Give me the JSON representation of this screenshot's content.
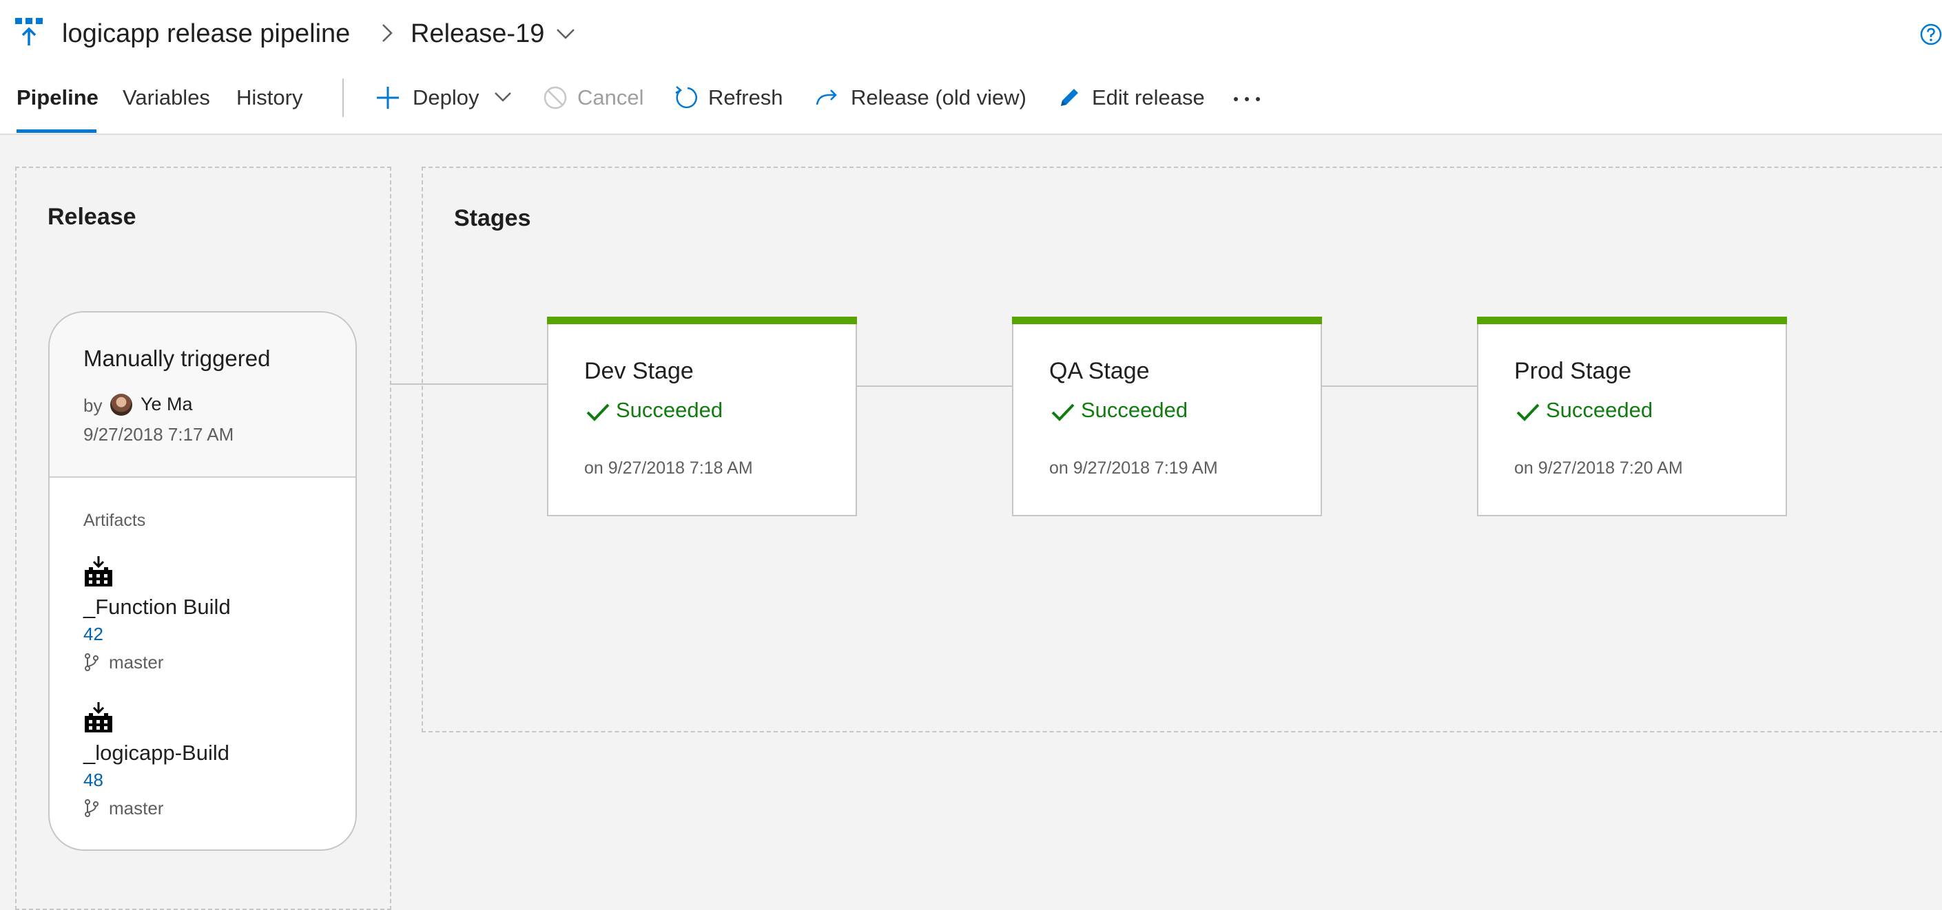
{
  "breadcrumb": {
    "pipeline_name": "logicapp release pipeline",
    "release_name": "Release-19"
  },
  "tabs": [
    {
      "label": "Pipeline",
      "active": true
    },
    {
      "label": "Variables",
      "active": false
    },
    {
      "label": "History",
      "active": false
    }
  ],
  "toolbar": {
    "deploy_label": "Deploy",
    "cancel_label": "Cancel",
    "refresh_label": "Refresh",
    "release_old_view_label": "Release (old view)",
    "edit_release_label": "Edit release"
  },
  "release_panel": {
    "title": "Release",
    "trigger": "Manually triggered",
    "by_label": "by",
    "author": "Ye Ma",
    "date": "9/27/2018 7:17 AM",
    "artifacts_label": "Artifacts",
    "artifacts": [
      {
        "name": "_Function Build",
        "build": "42",
        "branch": "master",
        "icon": "build-artifact-icon"
      },
      {
        "name": "_logicapp-Build",
        "build": "48",
        "branch": "master",
        "icon": "build-artifact-icon"
      }
    ]
  },
  "stages_panel": {
    "title": "Stages",
    "stages": [
      {
        "name": "Dev Stage",
        "status": "Succeeded",
        "date": "on 9/27/2018 7:18 AM"
      },
      {
        "name": "QA Stage",
        "status": "Succeeded",
        "date": "on 9/27/2018 7:19 AM"
      },
      {
        "name": "Prod Stage",
        "status": "Succeeded",
        "date": "on 9/27/2018 7:20 AM"
      }
    ]
  },
  "colors": {
    "accent": "#0078d4",
    "success": "#107c10",
    "stage_bar": "#57a300",
    "link": "#0063b1",
    "disabled": "#a19f9d"
  },
  "icons": {
    "pipeline": "release-pipeline-icon",
    "breadcrumb_separator": "chevron-right-icon",
    "release_dropdown": "chevron-down-icon",
    "help": "help-icon",
    "deploy": "plus-icon",
    "cancel": "cancel-icon",
    "refresh": "refresh-icon",
    "release_old_view": "redo-arrow-icon",
    "edit": "pencil-icon",
    "more": "more-ellipsis-icon",
    "status": "checkmark-icon",
    "branch": "branch-icon"
  }
}
